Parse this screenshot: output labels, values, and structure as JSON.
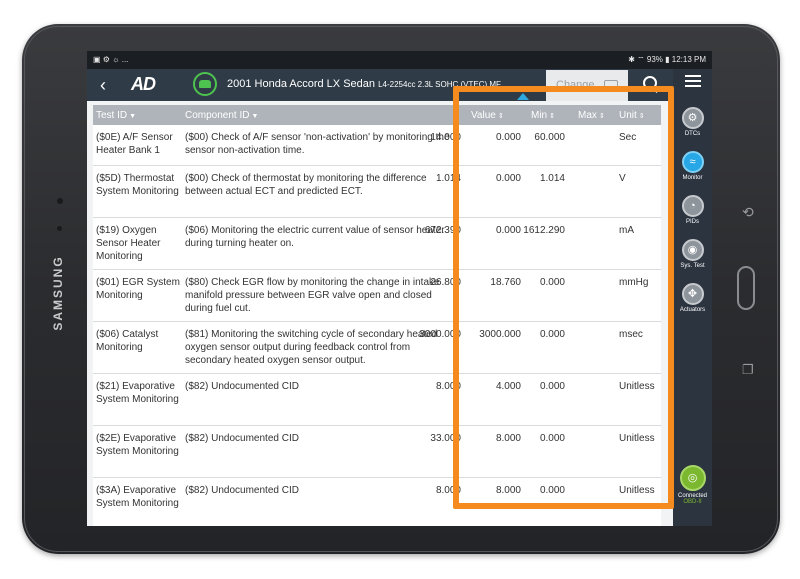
{
  "device": {
    "brand": "SAMSUNG"
  },
  "status_bar": {
    "left": "▣ ⚙ ☼ ...",
    "right": "✱ ⌔ 93% ▮ 12:13 PM"
  },
  "app": {
    "logo": "AD",
    "vehicle_title": "2001 Honda Accord LX Sedan",
    "vehicle_sub": "L4-2254cc 2.3L SOHC (VTEC) MF...",
    "change_label": "Change"
  },
  "sidebar": {
    "items": [
      {
        "label": "DTCs",
        "icon": "engine-icon"
      },
      {
        "label": "Monitor",
        "icon": "monitor-icon"
      },
      {
        "label": "PIDs",
        "icon": "gauge-icon"
      },
      {
        "label": "Sys. Test",
        "icon": "system-test-icon"
      },
      {
        "label": "Actuators",
        "icon": "actuators-icon"
      }
    ],
    "connected": {
      "label": "Connected",
      "sub": "OBD-II"
    }
  },
  "table": {
    "headers": {
      "test_id": "Test ID",
      "component_id": "Component ID",
      "value": "Value",
      "min": "Min",
      "max": "Max",
      "unit": "Unit"
    },
    "rows": [
      {
        "test_id": "($0E) A/F Sensor Heater Bank 1",
        "component": "($00) Check of A/F sensor 'non-activation' by monitoring the sensor non-activation time.",
        "value": "14.000",
        "min": "0.000",
        "max": "60.000",
        "unit": "Sec"
      },
      {
        "test_id": "($5D) Thermostat System Monitoring",
        "component": "($00) Check of thermostat by monitoring the difference between actual ECT and predicted ECT.",
        "value": "1.014",
        "min": "0.000",
        "max": "1.014",
        "unit": "V"
      },
      {
        "test_id": "($19) Oxygen Sensor Heater Monitoring",
        "component": "($06) Monitoring the electric current value of sensor heater during turning heater on.",
        "value": "672.390",
        "min": "0.000",
        "max": "1612.290",
        "unit": "mA"
      },
      {
        "test_id": "($01) EGR System Monitoring",
        "component": "($80) Check EGR flow by monitoring the change in intake manifold pressure between EGR valve open and closed during fuel cut.",
        "value": "26.800",
        "min": "18.760",
        "max": "0.000",
        "unit": "mmHg"
      },
      {
        "test_id": "($06) Catalyst Monitoring",
        "component": "($81) Monitoring the switching cycle of secondary heated oxygen sensor output during feedback control from secondary heated oxygen sensor output.",
        "value": "3000.000",
        "min": "3000.000",
        "max": "0.000",
        "unit": "msec"
      },
      {
        "test_id": "($21) Evaporative System Monitoring",
        "component": "($82) Undocumented CID",
        "value": "8.000",
        "min": "4.000",
        "max": "0.000",
        "unit": "Unitless"
      },
      {
        "test_id": "($2E) Evaporative System Monitoring",
        "component": "($82) Undocumented CID",
        "value": "33.000",
        "min": "8.000",
        "max": "0.000",
        "unit": "Unitless"
      },
      {
        "test_id": "($3A) Evaporative System Monitoring",
        "component": "($82) Undocumented CID",
        "value": "8.000",
        "min": "8.000",
        "max": "0.000",
        "unit": "Unitless"
      }
    ]
  },
  "colors": {
    "highlight": "#f58a1f",
    "accent": "#27a7e6",
    "connected": "#7cb82f",
    "topbar": "#2f3b46"
  }
}
